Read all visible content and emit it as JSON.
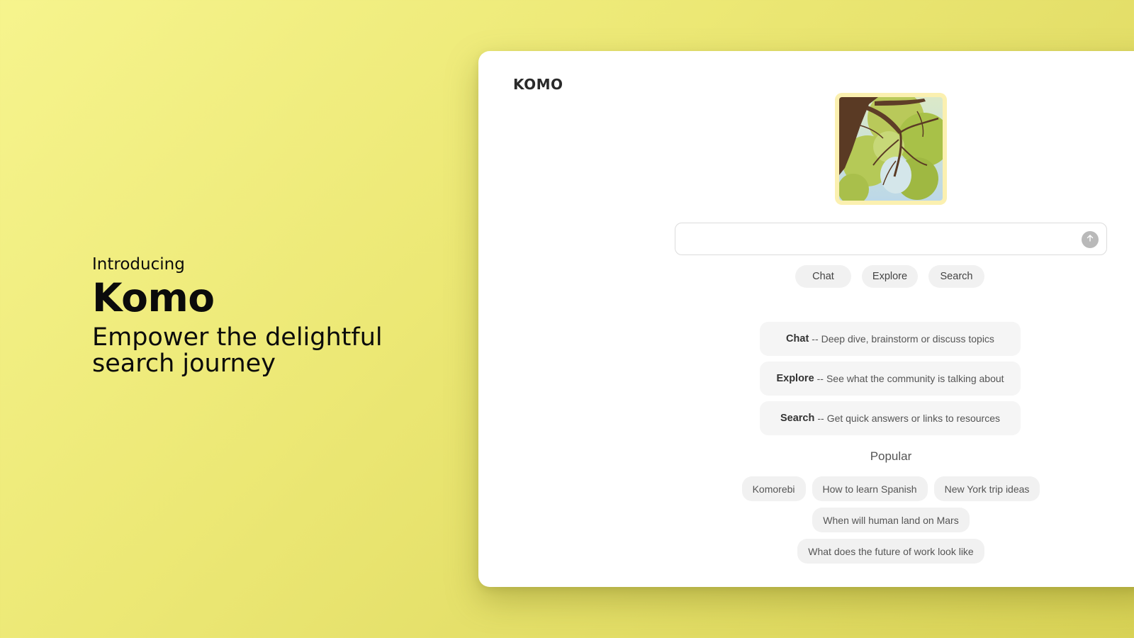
{
  "hero": {
    "intro": "Introducing",
    "title": "Komo",
    "tagline": "Empower the delightful search journey"
  },
  "app": {
    "logo": "KOMO",
    "search": {
      "value": "",
      "placeholder": "",
      "send_icon": "arrow-up-icon"
    },
    "modes": [
      "Chat",
      "Explore",
      "Search"
    ],
    "mode_descriptions": [
      {
        "name": "Chat",
        "separator": "--",
        "text": "Deep dive, brainstorm or discuss topics"
      },
      {
        "name": "Explore",
        "separator": "--",
        "text": "See what the community is talking about"
      },
      {
        "name": "Search",
        "separator": "--",
        "text": "Get quick answers or links to resources"
      }
    ],
    "popular": {
      "title": "Popular",
      "items": [
        "Komorebi",
        "How to learn Spanish",
        "New York trip ideas",
        "When will human land on Mars",
        "What does the future of work look like"
      ]
    }
  },
  "colors": {
    "background": "#ece875",
    "card": "#ffffff",
    "pill": "#f1f1f1",
    "send_button": "#b9b9b9"
  }
}
